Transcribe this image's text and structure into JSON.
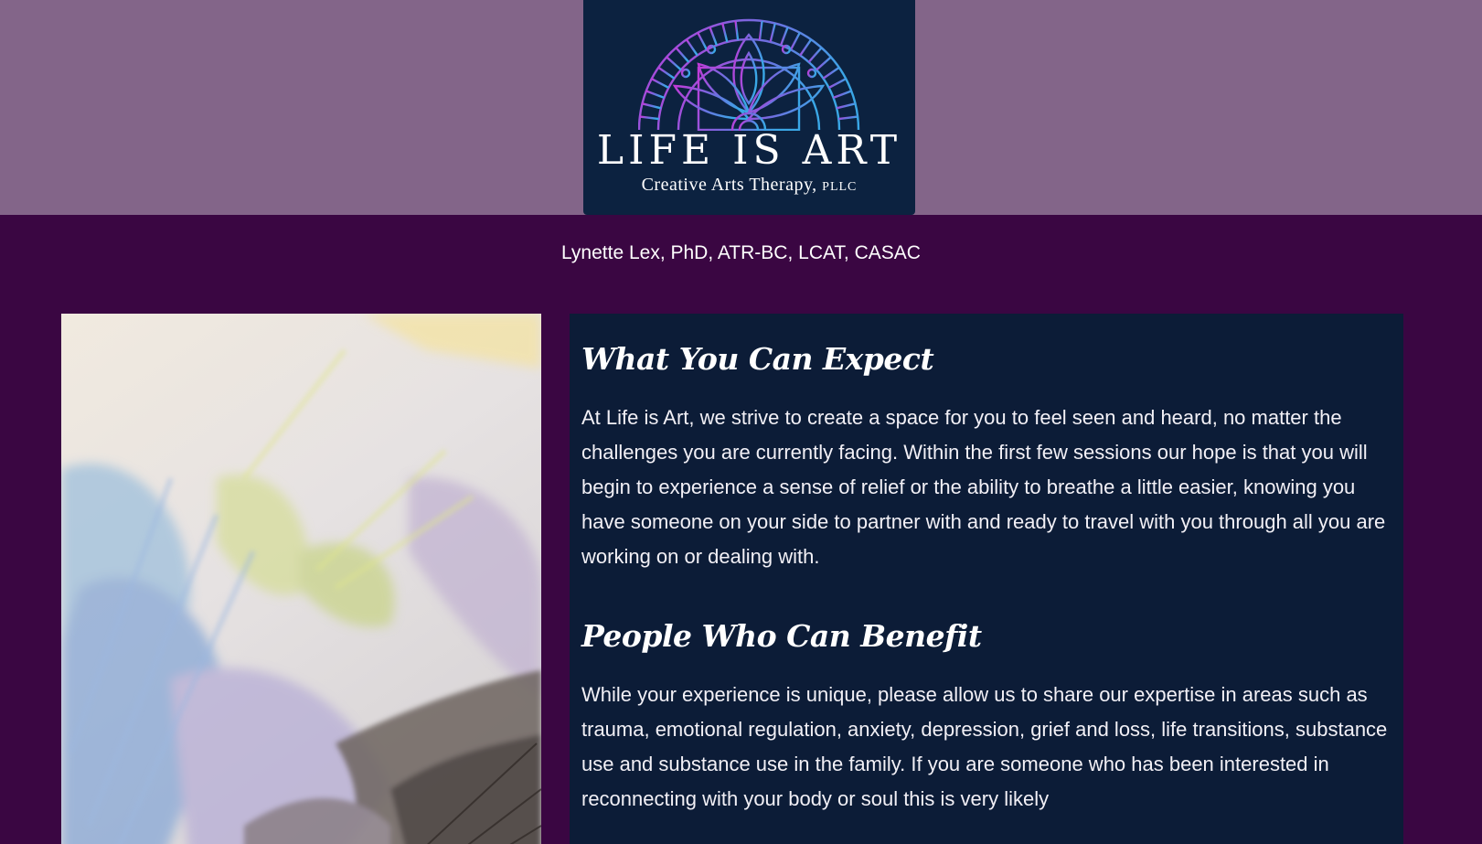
{
  "header": {
    "logo": {
      "title": "LIFE IS ART",
      "subtitle_main": "Creative Arts Therapy,",
      "subtitle_suffix": "PLLC",
      "icon": "mandala-lotus-icon"
    },
    "credentials": "Lynette Lex, PhD, ATR-BC, LCAT, CASAC"
  },
  "main": {
    "image": {
      "icon": "abstract-watercolor-painting"
    },
    "sections": [
      {
        "heading": "What You Can Expect",
        "body": "At Life is Art, we strive to create a space for you to feel seen and heard, no matter the challenges you are currently facing. Within the first few sessions our hope is that you will begin to experience a sense of relief or the ability to breathe a little easier, knowing you have someone on your side to partner with and ready to travel with you through all you are working on or dealing with."
      },
      {
        "heading": "People Who Can Benefit",
        "body": "While your experience is unique, please allow us to share our expertise in areas such as trauma, emotional regulation, anxiety, depression, grief and loss, life transitions, substance use and substance use in the family. If you are someone who has been interested in reconnecting with your body or soul this is very likely"
      }
    ]
  },
  "colors": {
    "top_band": "#836589",
    "page_background": "#3a0642",
    "logo_background": "#0c2240",
    "text_panel": "#0c1c37",
    "mandala_gradient_start": "#c23ad8",
    "mandala_gradient_end": "#3aa7e6"
  }
}
